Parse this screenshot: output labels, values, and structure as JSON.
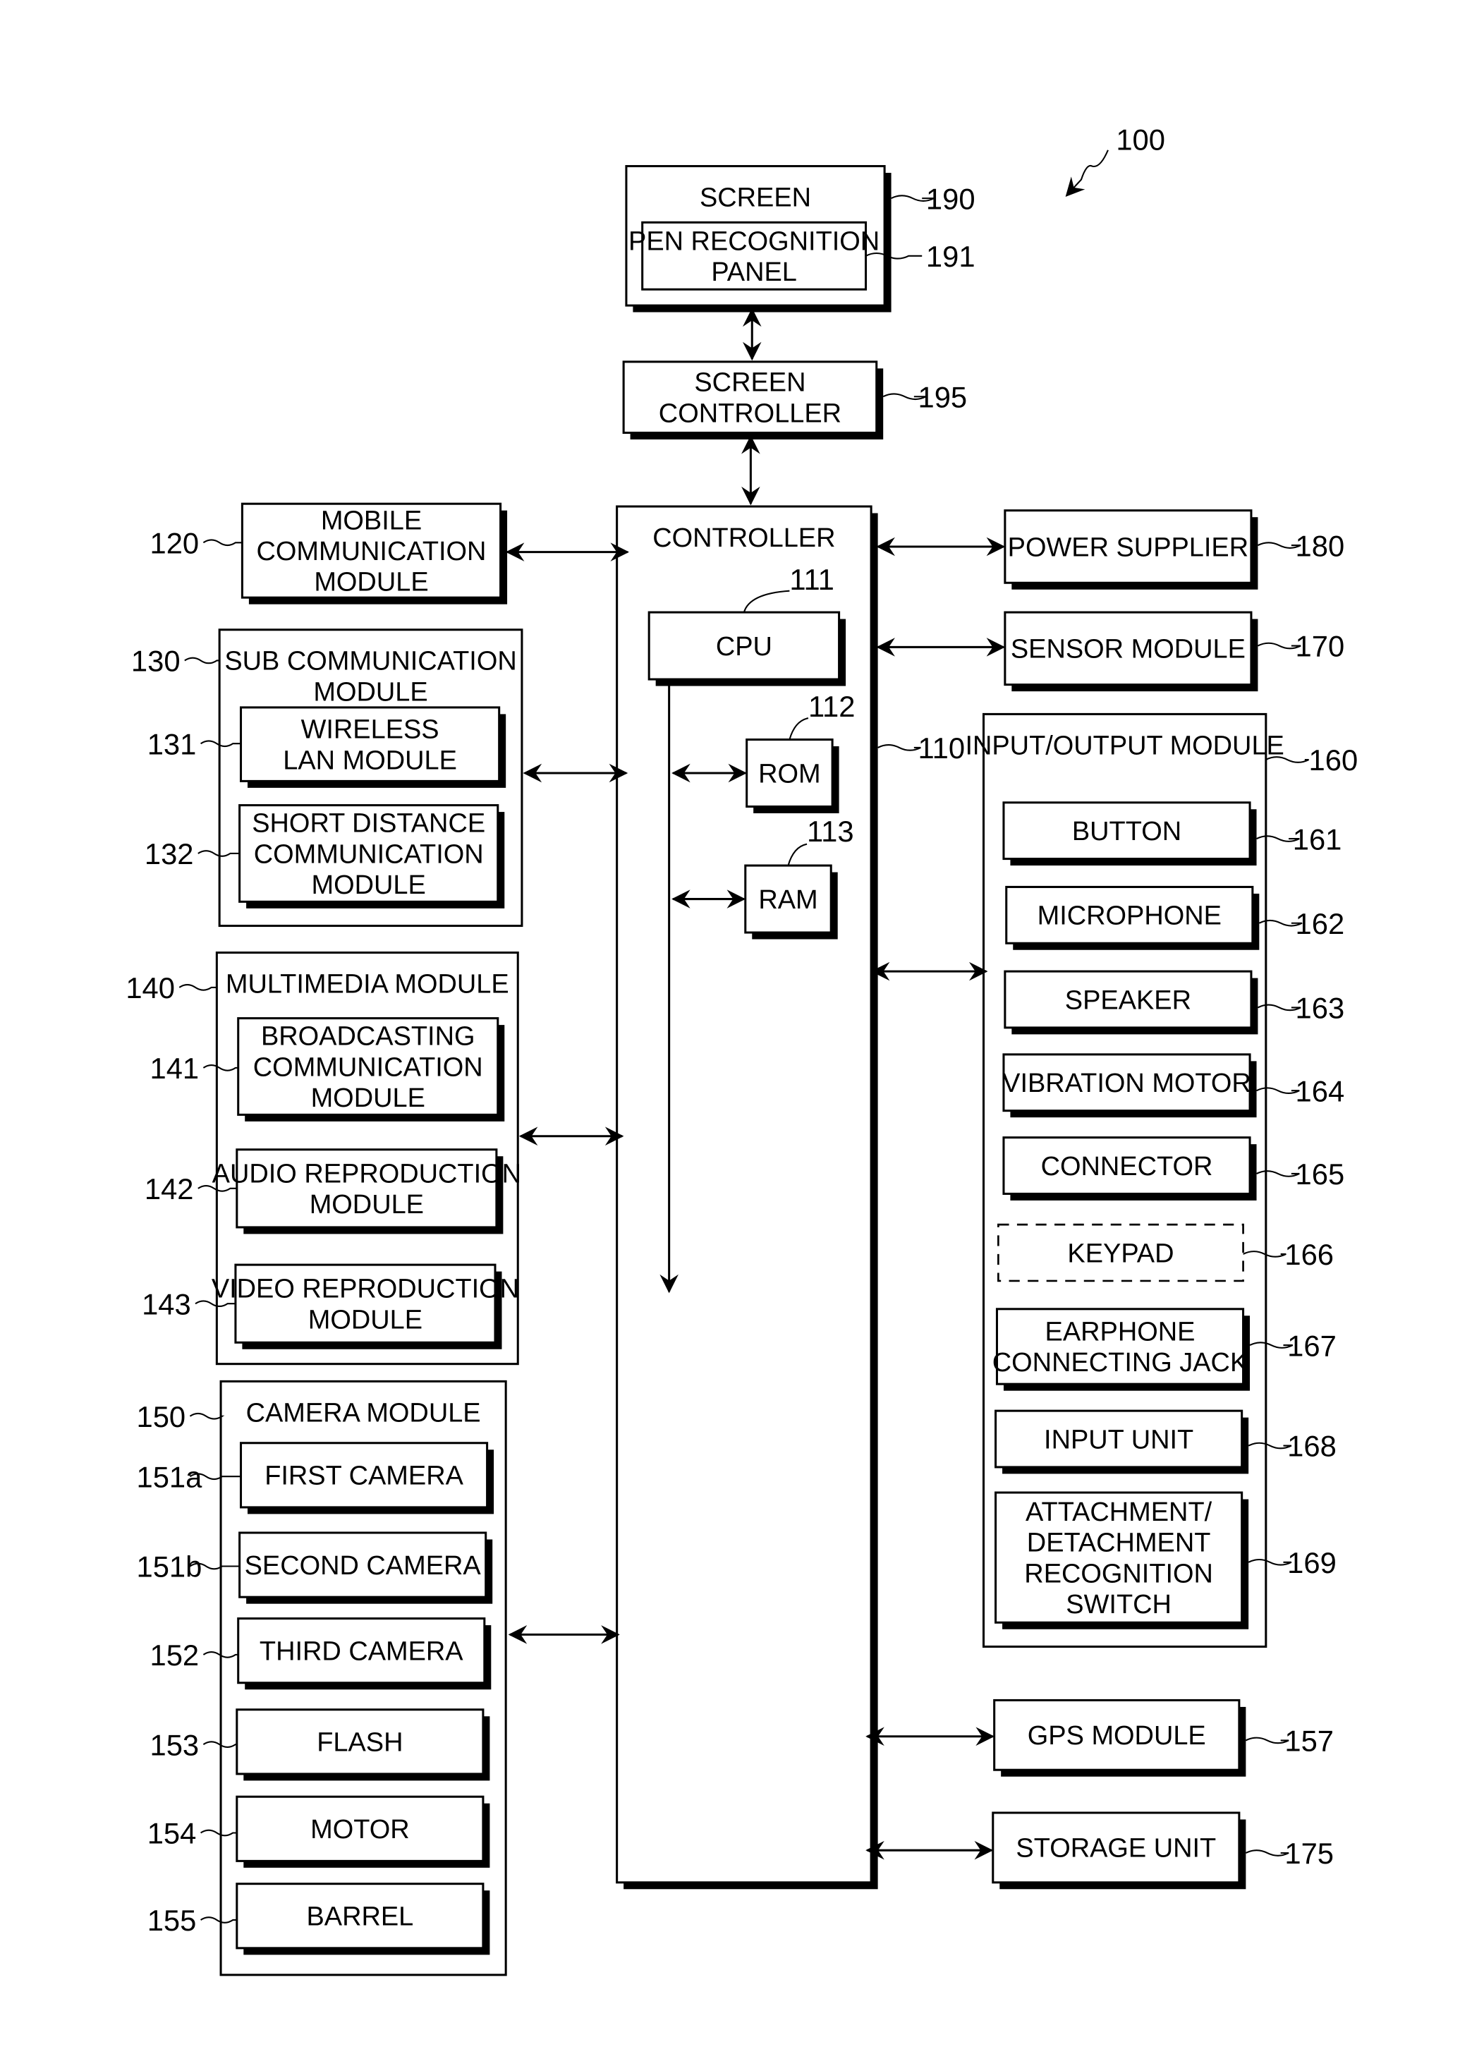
{
  "figure_ref": "100",
  "blocks": {
    "screen": {
      "ref": "190",
      "label": [
        "SCREEN"
      ]
    },
    "pen_recognition_panel": {
      "ref": "191",
      "label": [
        "PEN RECOGNITION",
        "PANEL"
      ]
    },
    "screen_controller": {
      "ref": "195",
      "label": [
        "SCREEN",
        "CONTROLLER"
      ]
    },
    "controller": {
      "ref": "110",
      "label": [
        "CONTROLLER"
      ]
    },
    "cpu": {
      "ref": "111",
      "label": [
        "CPU"
      ]
    },
    "rom": {
      "ref": "112",
      "label": [
        "ROM"
      ]
    },
    "ram": {
      "ref": "113",
      "label": [
        "RAM"
      ]
    },
    "mobile_communication_module": {
      "ref": "120",
      "label": [
        "MOBILE",
        "COMMUNICATION",
        "MODULE"
      ]
    },
    "sub_communication_module": {
      "ref": "130",
      "label": [
        "SUB COMMUNICATION",
        "MODULE"
      ]
    },
    "wireless_lan_module": {
      "ref": "131",
      "label": [
        "WIRELESS",
        "LAN MODULE"
      ]
    },
    "short_distance_communication_module": {
      "ref": "132",
      "label": [
        "SHORT DISTANCE",
        "COMMUNICATION",
        "MODULE"
      ]
    },
    "multimedia_module": {
      "ref": "140",
      "label": [
        "MULTIMEDIA MODULE"
      ]
    },
    "broadcasting_communication_module": {
      "ref": "141",
      "label": [
        "BROADCASTING",
        "COMMUNICATION",
        "MODULE"
      ]
    },
    "audio_reproduction_module": {
      "ref": "142",
      "label": [
        "AUDIO REPRODUCTION",
        "MODULE"
      ]
    },
    "video_reproduction_module": {
      "ref": "143",
      "label": [
        "VIDEO REPRODUCTION",
        "MODULE"
      ]
    },
    "camera_module": {
      "ref": "150",
      "label": [
        "CAMERA MODULE"
      ]
    },
    "first_camera": {
      "ref": "151a",
      "label": [
        "FIRST CAMERA"
      ]
    },
    "second_camera": {
      "ref": "151b",
      "label": [
        "SECOND CAMERA"
      ]
    },
    "third_camera": {
      "ref": "152",
      "label": [
        "THIRD CAMERA"
      ]
    },
    "flash": {
      "ref": "153",
      "label": [
        "FLASH"
      ]
    },
    "motor": {
      "ref": "154",
      "label": [
        "MOTOR"
      ]
    },
    "barrel": {
      "ref": "155",
      "label": [
        "BARREL"
      ]
    },
    "power_supplier": {
      "ref": "180",
      "label": [
        "POWER SUPPLIER"
      ]
    },
    "sensor_module": {
      "ref": "170",
      "label": [
        "SENSOR MODULE"
      ]
    },
    "input_output_module": {
      "ref": "160",
      "label": [
        "INPUT/OUTPUT MODULE"
      ]
    },
    "button": {
      "ref": "161",
      "label": [
        "BUTTON"
      ]
    },
    "microphone": {
      "ref": "162",
      "label": [
        "MICROPHONE"
      ]
    },
    "speaker": {
      "ref": "163",
      "label": [
        "SPEAKER"
      ]
    },
    "vibration_motor": {
      "ref": "164",
      "label": [
        "VIBRATION MOTOR"
      ]
    },
    "connector": {
      "ref": "165",
      "label": [
        "CONNECTOR"
      ]
    },
    "keypad": {
      "ref": "166",
      "label": [
        "KEYPAD"
      ]
    },
    "earphone_connecting_jack": {
      "ref": "167",
      "label": [
        "EARPHONE",
        "CONNECTING JACK"
      ]
    },
    "input_unit": {
      "ref": "168",
      "label": [
        "INPUT UNIT"
      ]
    },
    "attachment_detachment_recognition_switch": {
      "ref": "169",
      "label": [
        "ATTACHMENT/",
        "DETACHMENT",
        "RECOGNITION",
        "SWITCH"
      ]
    },
    "gps_module": {
      "ref": "157",
      "label": [
        "GPS MODULE"
      ]
    },
    "storage_unit": {
      "ref": "175",
      "label": [
        "STORAGE UNIT"
      ]
    }
  }
}
